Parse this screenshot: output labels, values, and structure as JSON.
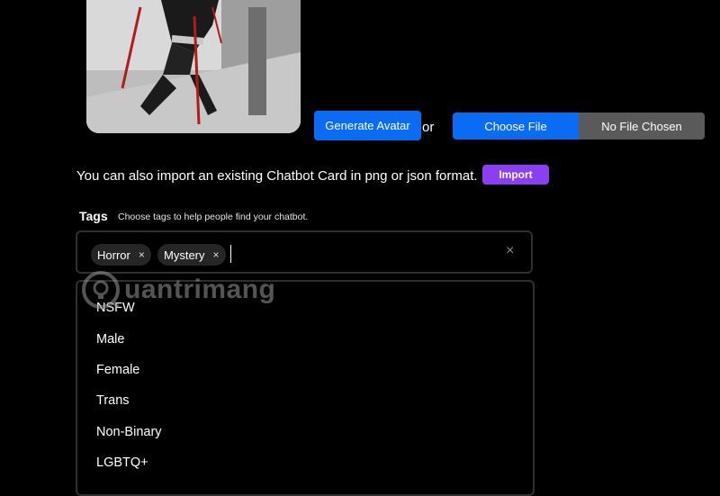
{
  "avatar": {
    "alt": "character avatar"
  },
  "actions": {
    "generate_avatar_label": "Generate Avatar",
    "or_label": "or",
    "choose_file_label": "Choose File",
    "no_file_label": "No File Chosen"
  },
  "import": {
    "text": "You can also import an existing Chatbot Card in png or json format.",
    "button_label": "Import"
  },
  "tags": {
    "label": "Tags",
    "hint": "Choose tags to help people find your chatbot.",
    "selected": [
      "Horror",
      "Mystery"
    ],
    "remove_symbol": "×",
    "clear_symbol": "×"
  },
  "dropdown": {
    "options": [
      "NSFW",
      "Male",
      "Female",
      "Trans",
      "Non-Binary",
      "LGBTQ+"
    ]
  },
  "watermark": {
    "text": "uantrimang"
  },
  "colors": {
    "primary": "#0a6cf5",
    "import": "#8a3ff2",
    "file_status": "#5a5a5a"
  }
}
